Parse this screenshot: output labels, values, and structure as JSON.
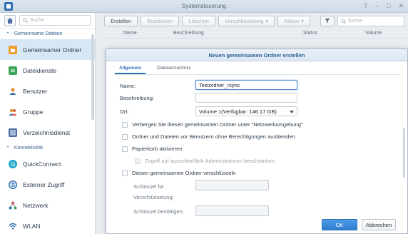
{
  "window": {
    "title": "Systemsteuerung",
    "controls": [
      "?",
      "–",
      "□",
      "✕"
    ]
  },
  "sidebar": {
    "search_placeholder": "Suche",
    "sections": [
      {
        "label": "Gemeinsame Dateien"
      },
      {
        "label": "Konnektivität"
      }
    ],
    "items": [
      {
        "label": "Gemeinsamer Ordner",
        "icon": "shared-folder-icon",
        "color": "#f0a030"
      },
      {
        "label": "Dateidienste",
        "icon": "file-services-icon",
        "color": "#3aa757"
      },
      {
        "label": "Benutzer",
        "icon": "user-icon",
        "color": "#e08a2c"
      },
      {
        "label": "Gruppe",
        "icon": "group-icon",
        "color": "#e08a2c"
      },
      {
        "label": "Verzeichnisdienst",
        "icon": "directory-service-icon",
        "color": "#4a6fa5"
      },
      {
        "label": "QuickConnect",
        "icon": "quickconnect-icon",
        "color": "#1fa7c9"
      },
      {
        "label": "Externer Zugriff",
        "icon": "globe-icon",
        "color": "#2f6fb5"
      },
      {
        "label": "Netzwerk",
        "icon": "network-icon",
        "color": "#d9534f"
      },
      {
        "label": "WLAN",
        "icon": "wifi-icon",
        "color": "#2f6fb5"
      }
    ]
  },
  "toolbar": {
    "create": "Erstellen",
    "edit": "Bearbeiten",
    "delete": "Löschen",
    "encryption": "Verschlüsselung",
    "action": "Aktion",
    "search_placeholder": "Suche"
  },
  "table": {
    "columns": [
      "Name",
      "Beschreibung",
      "Status",
      "Volume"
    ]
  },
  "dialog": {
    "title": "Neuen gemeinsamen Ordner erstellen",
    "tabs": [
      "Allgemein",
      "Dateiverzeichnis"
    ],
    "name_label": "Name:",
    "name_value": "Testordner_rsync",
    "description_label": "Beschreibung:",
    "description_value": "",
    "location_label": "Ort:",
    "location_value": "Volume 1(Verfügbar: 146.17 GB)",
    "checkboxes": [
      "Verbergen Sie diesen gemeinsamen Ordner unter \"Netzwerkumgebung\"",
      "Ordner und Dateien vor Benutzern ohne Berechtigungen ausblenden",
      "Papierkorb aktivieren",
      "Zugriff auf ausschließlich Administratoren beschränken",
      "Diesen gemeinsamen Ordner verschlüsseln"
    ],
    "key_label_1": "Schlüssel für",
    "key_label_2": "Verschlüsselung:",
    "key_confirm_label": "Schlüssel bestätigen:",
    "ok": "OK",
    "cancel": "Abbrechen",
    "accent": "#2f7fcf"
  }
}
